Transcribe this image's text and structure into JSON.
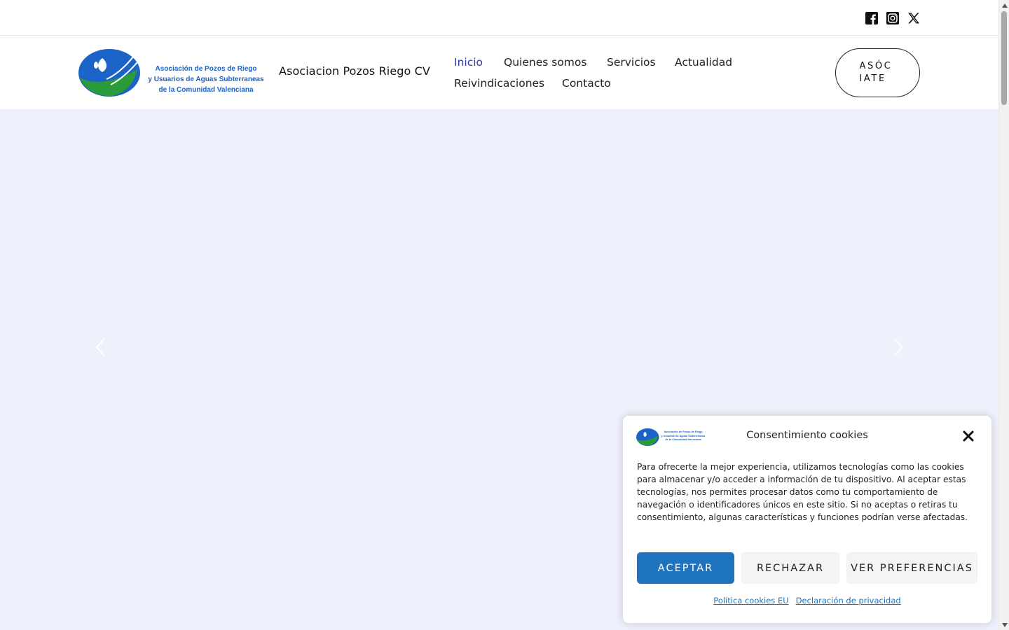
{
  "topbar": {
    "social": [
      {
        "name": "facebook-icon"
      },
      {
        "name": "instagram-icon"
      },
      {
        "name": "x-twitter-icon"
      }
    ]
  },
  "header": {
    "logo_text": [
      "Asociación de Pozos de Riego",
      "y Usuarios de Aguas Subterraneas",
      "de la Comunidad Valenciana"
    ],
    "site_title": "Asociacion Pozos Riego CV",
    "nav": [
      {
        "label": "Inicio",
        "active": true
      },
      {
        "label": "Quienes somos",
        "active": false
      },
      {
        "label": "Servicios",
        "active": false
      },
      {
        "label": "Actualidad",
        "active": false
      },
      {
        "label": "Reivindicaciones",
        "active": false
      },
      {
        "label": "Contacto",
        "active": false
      }
    ],
    "cta_label": "ASÓCIATE"
  },
  "hero": {
    "prev_icon": "chevron-left-icon",
    "next_icon": "chevron-right-icon"
  },
  "cookie": {
    "title": "Consentimiento cookies",
    "body": "Para ofrecerte la mejor experiencia, utilizamos tecnologías como las cookies para almacenar y/o acceder a información de tu dispositivo. Al aceptar estas tecnologías, nos permites procesar datos como tu comportamiento de navegación o identificadores únicos en este sitio. Si no aceptas o retiras tu consentimiento, algunas características y funciones podrían verse afectadas.",
    "accept_label": "ACEPTAR",
    "reject_label": "RECHAZAR",
    "prefs_label": "VER PREFERENCIAS",
    "links": [
      "Política cookies EU",
      "Declaración de privacidad"
    ]
  },
  "colors": {
    "accent_blue": "#1e73be",
    "nav_active": "#2c3aa8",
    "hero_bg": "#eef0fb",
    "logo_green": "#2a9a3a"
  }
}
